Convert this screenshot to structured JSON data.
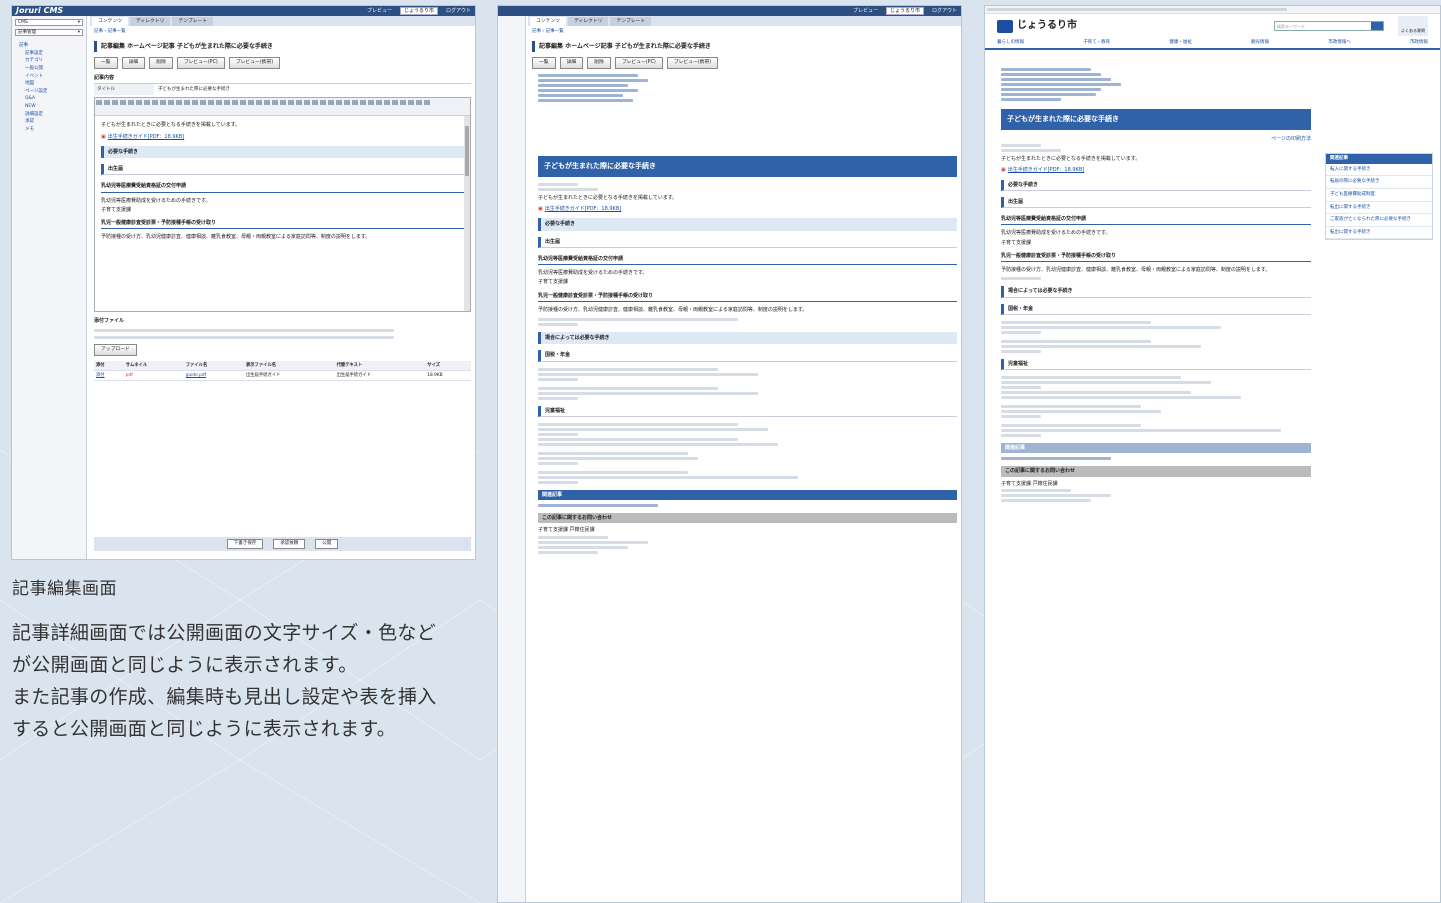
{
  "caption": "記事編集画面",
  "description": [
    "記事詳細画面では公開画面の文字サイズ・色など",
    "が公開画面と同じように表示されます。",
    "また記事の作成、編集時も見出し設定や表を挿入",
    "すると公開画面と同じように表示されます。"
  ],
  "cms": {
    "logo": "Joruri CMS",
    "top_links": [
      "プレビュー",
      "ログアウト"
    ],
    "site_select": "じょうるり市",
    "sidebar_selects": [
      "CMS",
      "記事管理"
    ],
    "tree": [
      "記事",
      "記事設定",
      "カテゴリ",
      "一般公開",
      "イベント",
      "地図",
      "ページ設定",
      "Q&A",
      "NEW",
      "詳細設定",
      "承認",
      "メモ"
    ],
    "tabs": [
      "コンテンツ",
      "ディレクトリ",
      "テンプレート"
    ],
    "breadcrumb": "記事 › 記事一覧",
    "page_title": "記事編集 ホームページ記事 子どもが生まれた際に必要な手続き",
    "buttons": [
      "一覧",
      "詳細",
      "削除",
      "プレビュー(PC)",
      "プレビュー(携帯)"
    ],
    "section_body": "記事内容",
    "label_title": "タイトル",
    "value_title": "子どもが生まれた際に必要な手続き",
    "section_files": "添付ファイル",
    "upload_button": "アップロード",
    "file_table_headers": [
      "添付",
      "サムネイル",
      "ファイル名",
      "表示ファイル名",
      "代替テキスト",
      "サイズ"
    ],
    "file_row": [
      "添付",
      "pdf",
      "guide.pdf",
      "出生届手続ガイド",
      "出生届手続ガイド",
      "18.9KB"
    ],
    "footer_buttons": [
      "下書き保存",
      "承認依頼",
      "公開"
    ]
  },
  "article": {
    "intro": "子どもが生まれたときに必要となる手続きを掲載しています。",
    "pdf_link": "出生手続きガイド[PDF：18.9KB]",
    "h_required": "必要な手続き",
    "h_birth": "出生届",
    "h_medical": "乳幼児等医療費受給資格証の交付申請",
    "medical_text": "乳幼児等医療費助成を受けるための手続きです。",
    "child_section": "子育て支援課",
    "h_checkup": "乳児一般健康診査受診票・予防接種手帳の受け取り",
    "checkup_text": "予防接種の受け方、乳幼児健康診査、健康相談、離乳食教室、母親・両親教室による家庭訪問等、制度の説明をします。",
    "h_case": "場合によっては必要な手続き",
    "h_tax": "国税・年金",
    "h_welfare": "児童福祉",
    "preview_title": "子どもが生まれた際に必要な手続き",
    "related": "関連記事",
    "contact": "この記事に関するお問い合わせ",
    "dept": "子育て支援課 戸籍住民課"
  },
  "site": {
    "name": "じょうるり市",
    "search_placeholder": "検索キーワード",
    "help": "よくある質問",
    "gnav": [
      "暮らしの情報",
      "子育て・教育",
      "健康・福祉",
      "観光情報",
      "市政情報へ",
      "市政情報"
    ],
    "page_link": "ページの印刷方法",
    "side_title": "関連記事",
    "side_items": [
      "転入に関する手続き",
      "転居の際に必要な手続き",
      "子ども医療費助成制度",
      "転出に関する手続き",
      "ご家族が亡くなられた際に必要な手続き",
      "転出に関する手続き"
    ]
  }
}
